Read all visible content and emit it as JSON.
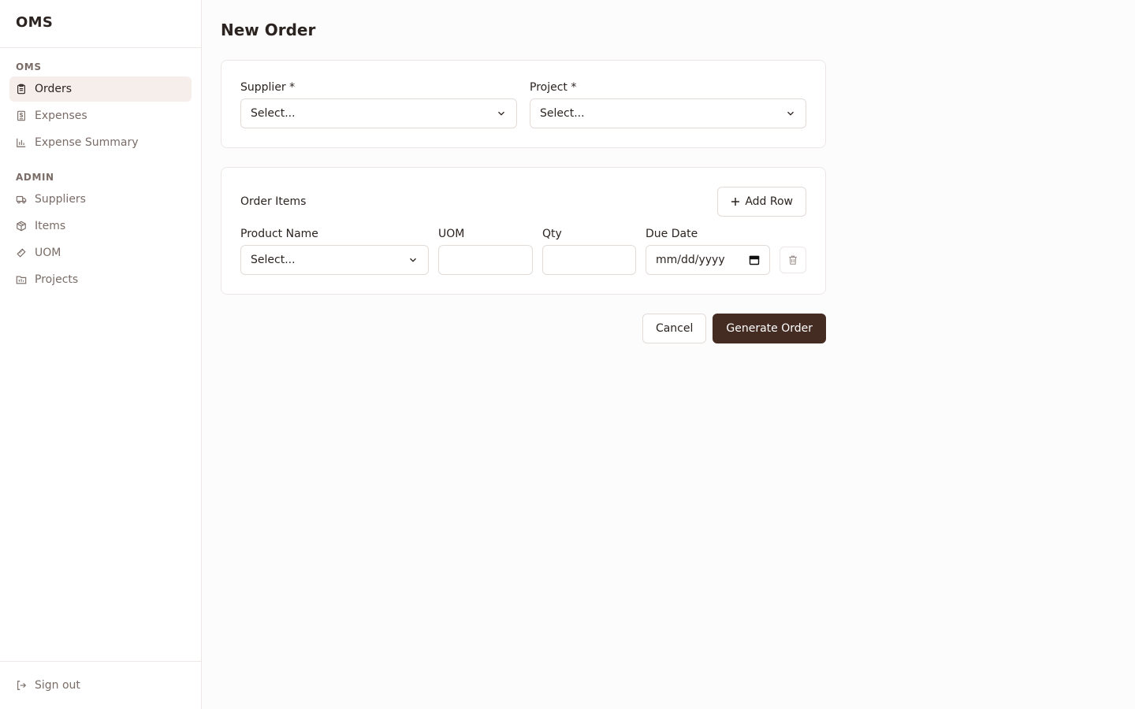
{
  "app": {
    "brand": "OMS"
  },
  "sidebar": {
    "sections": [
      {
        "label": "OMS",
        "items": [
          {
            "label": "Orders",
            "icon": "clipboard-icon",
            "active": true
          },
          {
            "label": "Expenses",
            "icon": "receipt-icon"
          },
          {
            "label": "Expense Summary",
            "icon": "bar-chart-icon"
          }
        ]
      },
      {
        "label": "ADMIN",
        "items": [
          {
            "label": "Suppliers",
            "icon": "truck-icon"
          },
          {
            "label": "Items",
            "icon": "package-icon"
          },
          {
            "label": "UOM",
            "icon": "ruler-icon"
          },
          {
            "label": "Projects",
            "icon": "folder-icon"
          }
        ]
      }
    ],
    "footer": {
      "signout_label": "Sign out",
      "icon": "logout-icon"
    }
  },
  "main": {
    "title": "New Order",
    "supplier": {
      "label": "Supplier *",
      "value": "Select..."
    },
    "project": {
      "label": "Project *",
      "value": "Select..."
    },
    "order_items": {
      "title": "Order Items",
      "add_row_label": "Add Row",
      "columns": {
        "product_name": "Product Name",
        "uom": "UOM",
        "qty": "Qty",
        "due_date": "Due Date"
      },
      "row": {
        "product_value": "Select...",
        "uom_value": "",
        "qty_value": "",
        "due_date_placeholder": "mm/dd/yyyy"
      }
    },
    "actions": {
      "cancel_label": "Cancel",
      "generate_label": "Generate Order"
    }
  },
  "colors": {
    "primary": "#452c23",
    "active_nav_bg": "#f6eeeb",
    "muted_text": "#7a6c67",
    "border": "#e2dcd9"
  }
}
